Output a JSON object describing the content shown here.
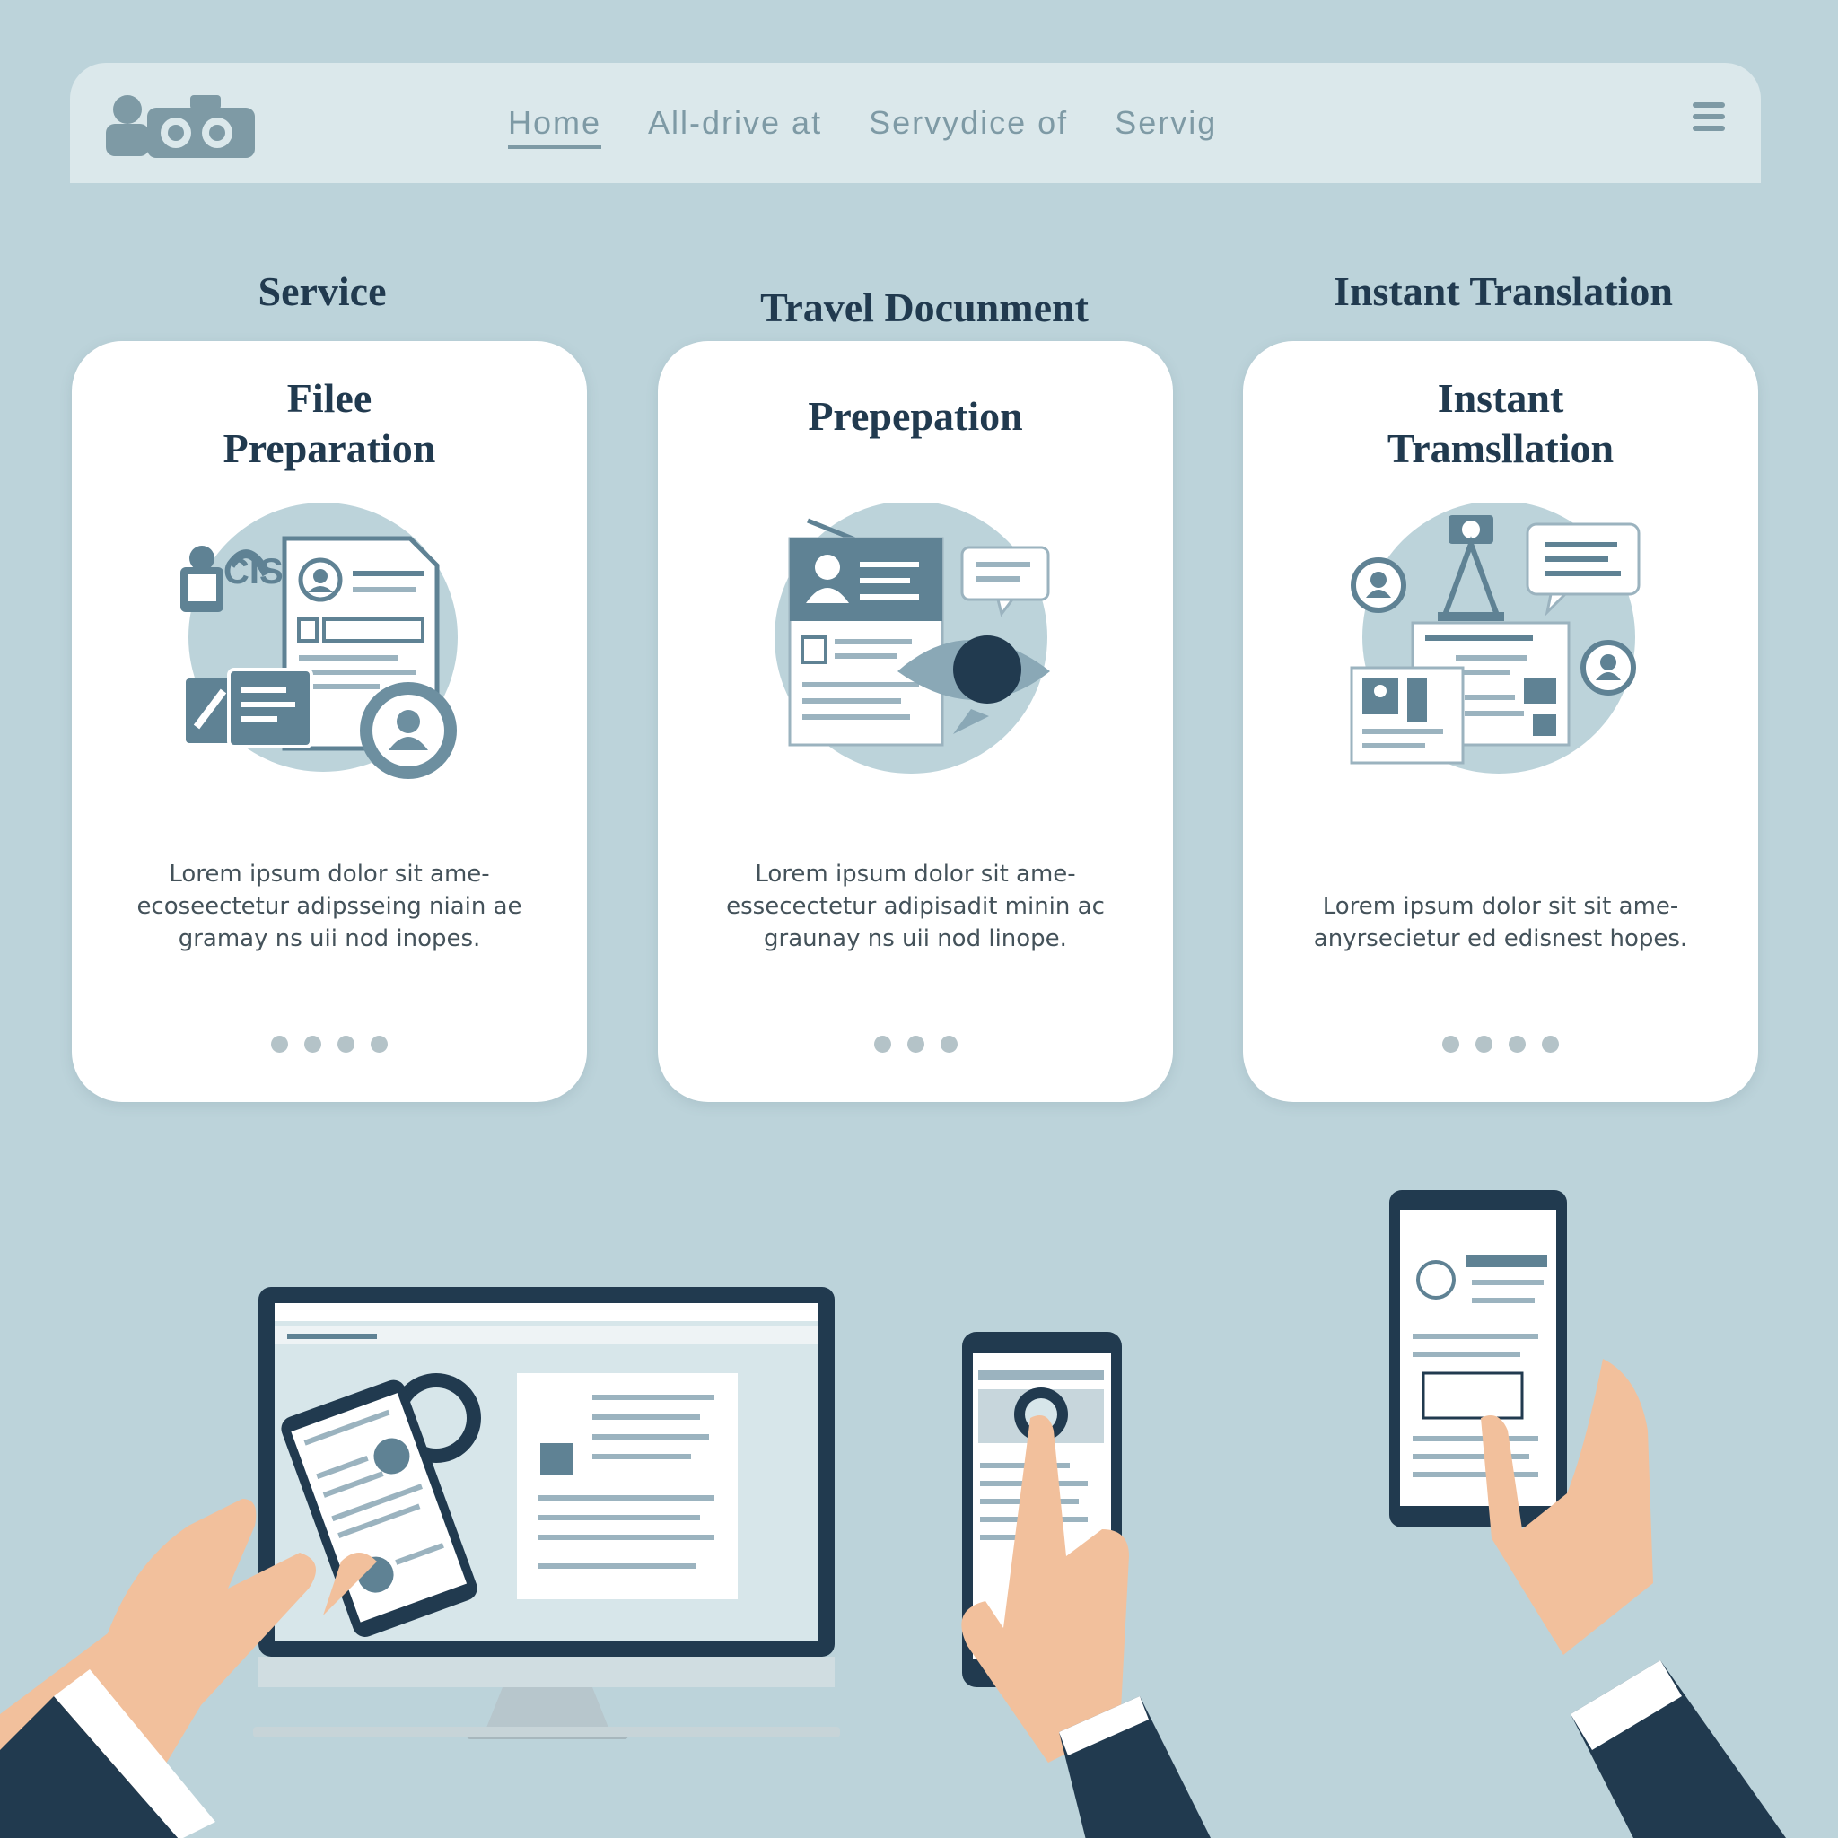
{
  "header": {
    "nav": [
      "Home",
      "All-drive at",
      "Servydice of",
      "Servig"
    ],
    "active_index": 0
  },
  "sections": [
    {
      "title": "Service"
    },
    {
      "title": "Travel Docunment"
    },
    {
      "title": "Instant Translation"
    }
  ],
  "cards": [
    {
      "title": "Filee\nPreparation",
      "icon": "file-preparation-illustration",
      "description": "Lorem ipsum dolor sit ame- ecoseectetur adipsseing niain ae gramay ns uii nod inopes.",
      "dots": 4
    },
    {
      "title": "Prepepation",
      "icon": "travel-document-illustration",
      "description": "Lorem ipsum dolor sit ame- essecectetur adipisadit minin ac graunay ns uii nod linope.",
      "dots": 3
    },
    {
      "title": "Instant\nTramsllation",
      "icon": "instant-translation-illustration",
      "description": "Lorem ipsum dolor sit sit ame- anyrsecietur ed edisnest hopes.",
      "dots": 4
    }
  ],
  "colors": {
    "background": "#bcd3da",
    "navy": "#213a4f",
    "slate": "#6d8fa0",
    "muted": "#7e9aa5",
    "skin": "#f2c09c"
  },
  "devices_illustration": "hands-using-laptop-and-phones-illustration"
}
